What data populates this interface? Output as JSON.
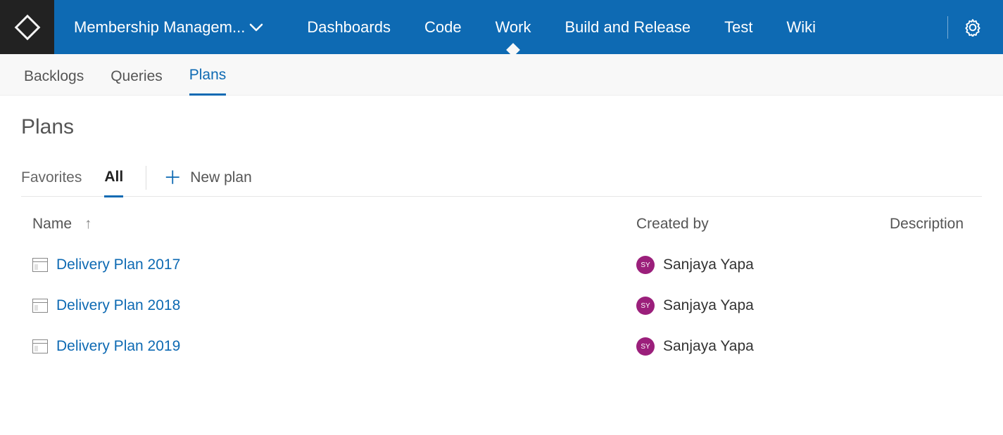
{
  "header": {
    "project_label": "Membership Managem...",
    "nav_items": [
      {
        "label": "Dashboards",
        "active": false
      },
      {
        "label": "Code",
        "active": false
      },
      {
        "label": "Work",
        "active": true
      },
      {
        "label": "Build and Release",
        "active": false
      },
      {
        "label": "Test",
        "active": false
      },
      {
        "label": "Wiki",
        "active": false
      }
    ]
  },
  "subnav": {
    "items": [
      {
        "label": "Backlogs",
        "active": false
      },
      {
        "label": "Queries",
        "active": false
      },
      {
        "label": "Plans",
        "active": true
      }
    ]
  },
  "page": {
    "title": "Plans",
    "filters": [
      {
        "label": "Favorites",
        "active": false
      },
      {
        "label": "All",
        "active": true
      }
    ],
    "new_plan_label": "New plan"
  },
  "table": {
    "columns": {
      "name": "Name",
      "created_by": "Created by",
      "description": "Description"
    },
    "rows": [
      {
        "name": "Delivery Plan 2017",
        "created_by": "Sanjaya Yapa",
        "avatar_initials": "SY",
        "description": ""
      },
      {
        "name": "Delivery Plan 2018",
        "created_by": "Sanjaya Yapa",
        "avatar_initials": "SY",
        "description": ""
      },
      {
        "name": "Delivery Plan 2019",
        "created_by": "Sanjaya Yapa",
        "avatar_initials": "SY",
        "description": ""
      }
    ]
  }
}
